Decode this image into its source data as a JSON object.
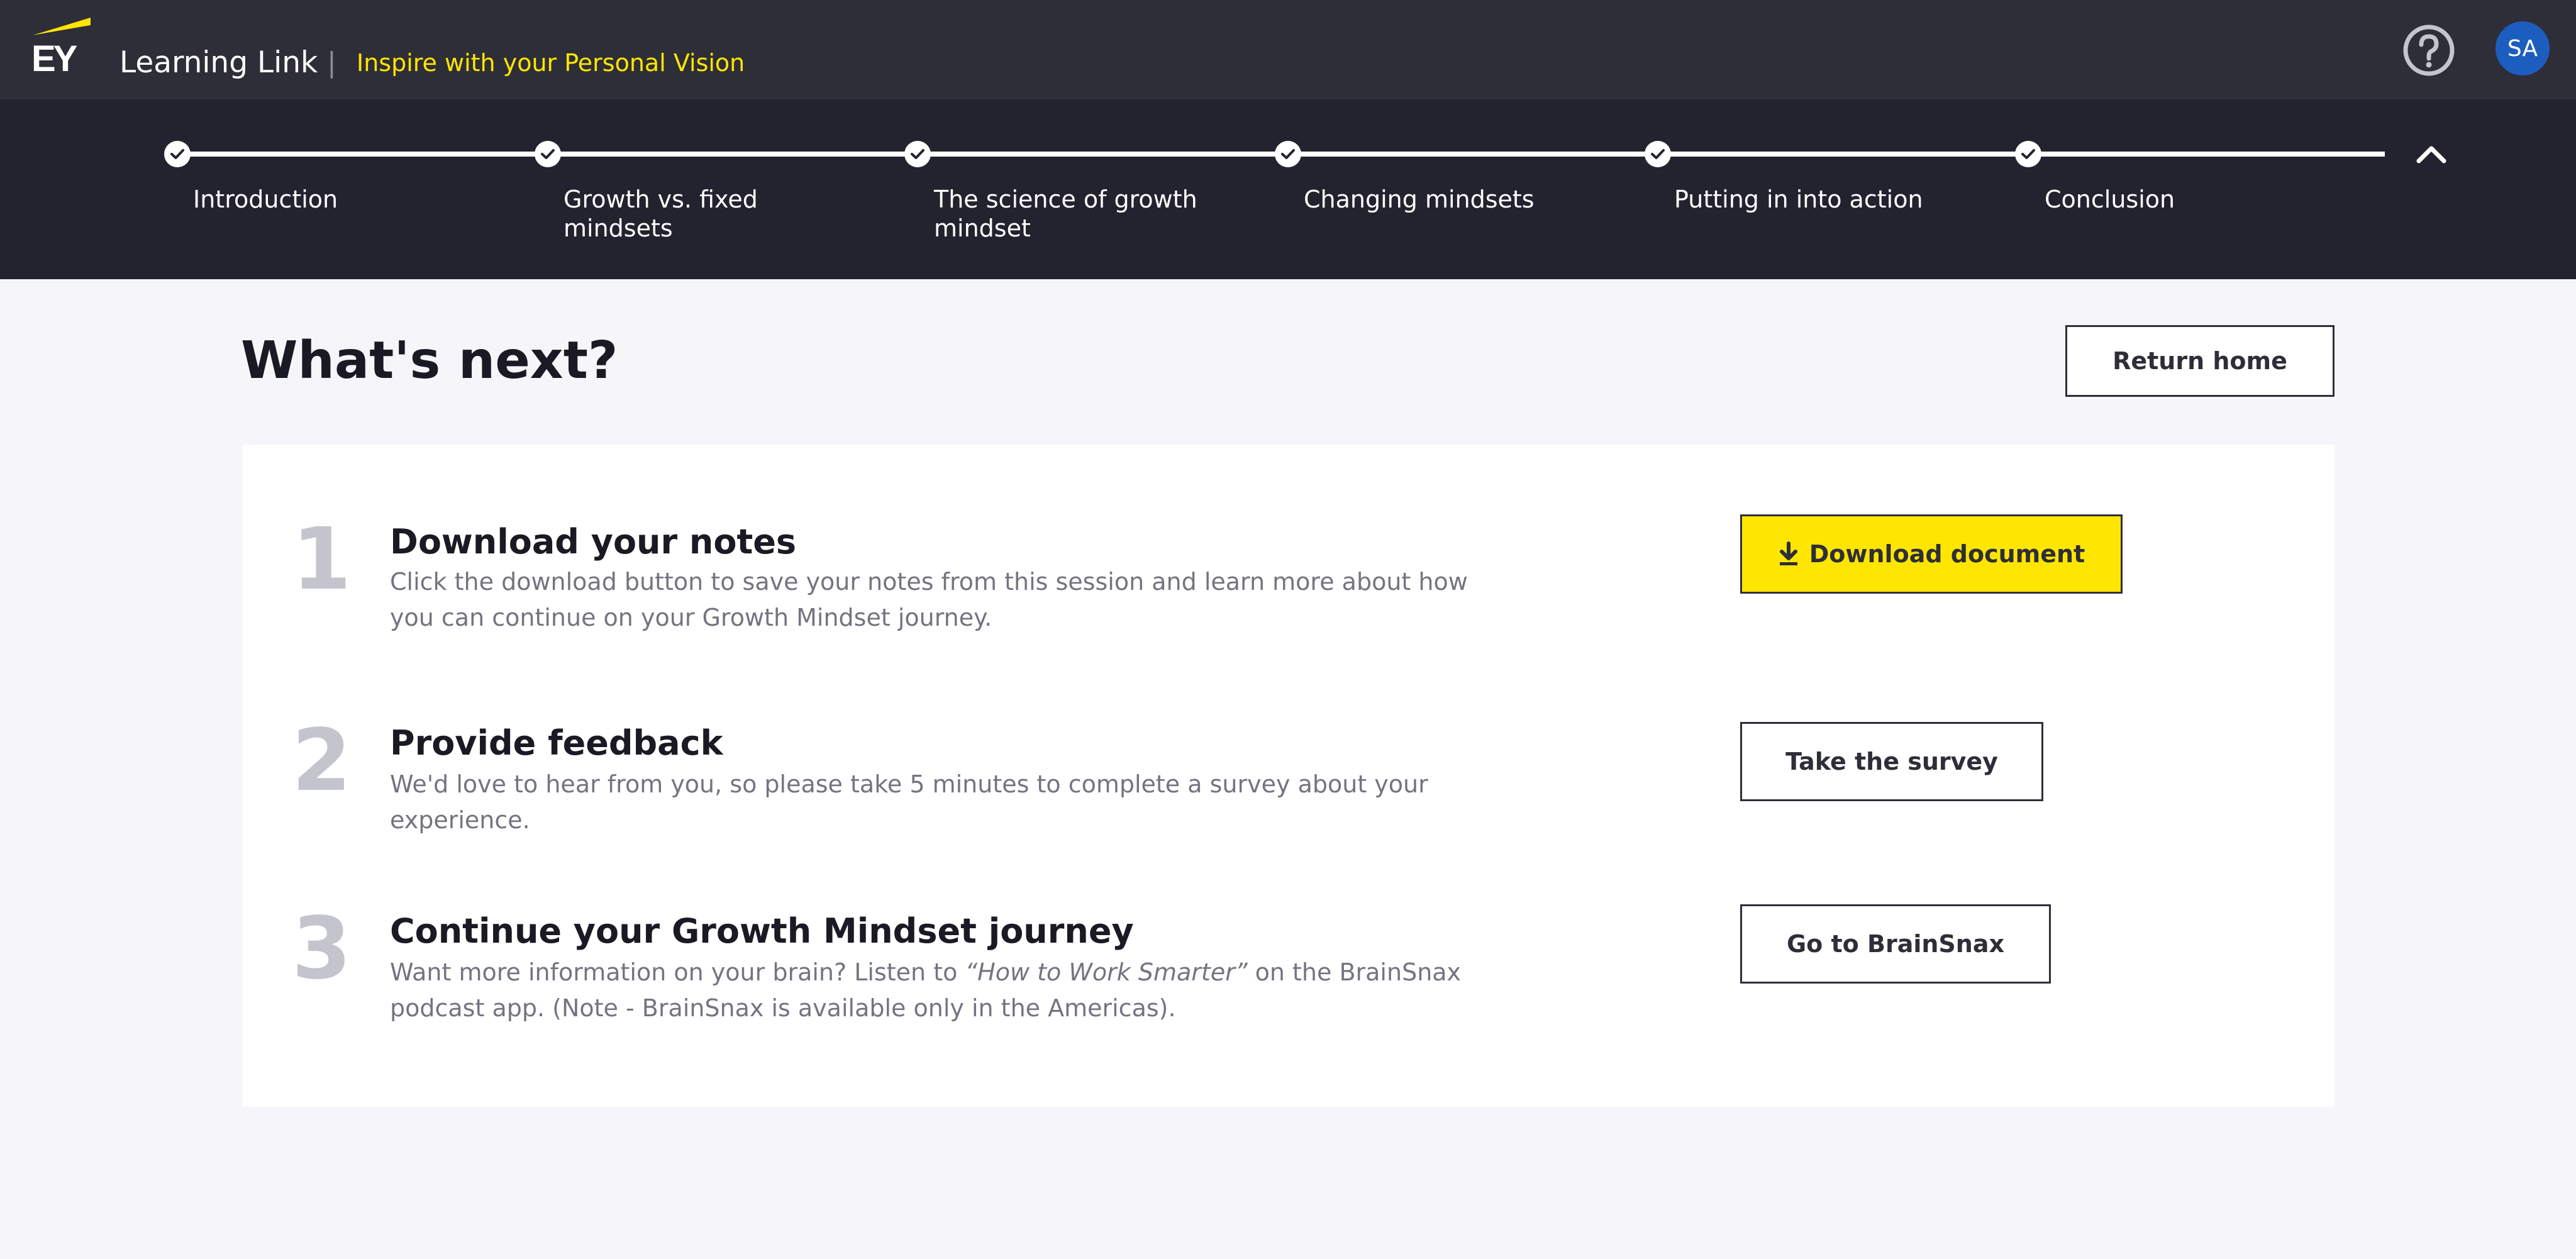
{
  "header": {
    "logo_text": "EY",
    "app_name": "Learning Link",
    "divider": "|",
    "course_title": "Inspire with your Personal Vision",
    "help_icon": "help-circle-icon",
    "avatar_initials": "SA"
  },
  "progress": {
    "steps": [
      {
        "label": "Introduction",
        "completed": true
      },
      {
        "label": "Growth vs. fixed mindsets",
        "completed": true
      },
      {
        "label": "The science of growth mindset",
        "completed": true
      },
      {
        "label": "Changing mindsets",
        "completed": true
      },
      {
        "label": "Putting in into action",
        "completed": true
      },
      {
        "label": "Conclusion",
        "completed": true
      }
    ],
    "collapse_icon": "chevron-up-icon"
  },
  "main": {
    "title": "What's next?",
    "return_home_label": "Return home",
    "items": [
      {
        "number": "1",
        "heading": "Download your notes",
        "text": "Click the download button to save your notes from this session and learn more about how you can continue on your Growth Mindset journey.",
        "button_label": "Download document",
        "button_icon": "download-icon"
      },
      {
        "number": "2",
        "heading": "Provide feedback",
        "text": "We'd love to hear from you, so please take 5 minutes to complete a survey about your experience.",
        "button_label": "Take the survey"
      },
      {
        "number": "3",
        "heading": "Continue your Growth Mindset journey",
        "text_before": "Want more information on your brain? Listen to ",
        "text_italic": "“How to Work Smarter”",
        "text_after": " on the BrainSnax podcast app. (Note - BrainSnax is available only in the Americas).",
        "button_label": "Go to BrainSnax"
      }
    ]
  },
  "colors": {
    "header_bg": "#2e2e38",
    "progress_bg": "#23232f",
    "accent_yellow": "#ffe600",
    "page_bg": "#f6f6fa",
    "avatar_bg": "#1c5ebf"
  }
}
